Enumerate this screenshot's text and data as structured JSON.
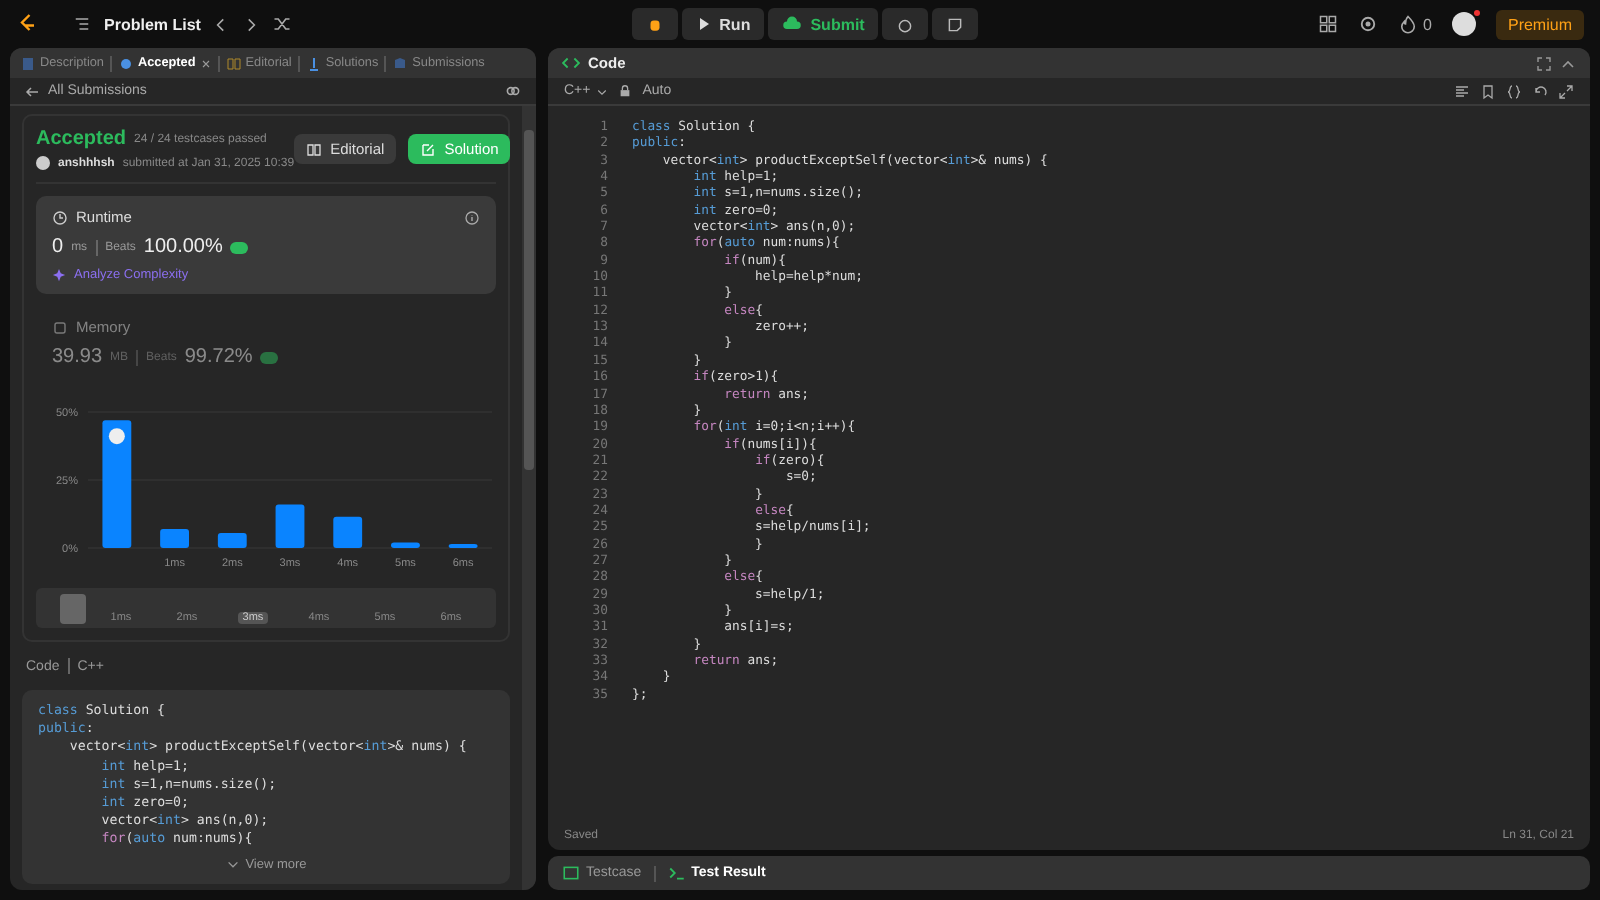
{
  "top_bar": {
    "problem_list": "Problem List",
    "run": "Run",
    "submit": "Submit",
    "streak": "0",
    "premium": "Premium"
  },
  "left_panel": {
    "tabs": [
      {
        "label": "Description",
        "selected": false,
        "closable": false
      },
      {
        "label": "Accepted",
        "selected": true,
        "closable": true
      },
      {
        "label": "Editorial",
        "selected": false,
        "closable": false
      },
      {
        "label": "Solutions",
        "selected": false,
        "closable": false
      },
      {
        "label": "Submissions",
        "selected": false,
        "closable": false
      }
    ],
    "back_link": "All Submissions",
    "result": {
      "status": "Accepted",
      "testcases": "24 / 24 testcases passed",
      "user": "anshhhsh",
      "submitted": "submitted at Jan 31, 2025 10:39",
      "editorial_button": "Editorial",
      "solution_button": "Solution"
    },
    "runtime": {
      "title": "Runtime",
      "value": "0",
      "unit": "ms",
      "beats_label": "Beats",
      "beats": "100.00%",
      "analyze": "Analyze Complexity",
      "selected": true
    },
    "memory": {
      "title": "Memory",
      "value": "39.93",
      "unit": "MB",
      "beats_label": "Beats",
      "beats": "99.72%",
      "selected": false
    },
    "chart_data": {
      "type": "bar",
      "categories": [
        null,
        "1ms",
        "2ms",
        "3ms",
        "4ms",
        "5ms",
        "6ms"
      ],
      "ylim": [
        0,
        50
      ],
      "yticks": [
        {
          "value": 0,
          "label": "0%"
        },
        {
          "value": 25,
          "label": "25%"
        },
        {
          "value": 50,
          "label": "50%"
        }
      ],
      "series": [
        {
          "color": "#0a84ff",
          "values": [
            47,
            7,
            5.5,
            16,
            11.5,
            2,
            1.5
          ]
        }
      ]
    },
    "overview": [
      {
        "label": "1ms",
        "selected": false
      },
      {
        "label": "2ms",
        "selected": false
      },
      {
        "label": "3ms",
        "selected": true
      },
      {
        "label": "4ms",
        "selected": false
      },
      {
        "label": "5ms",
        "selected": false
      },
      {
        "label": "6ms",
        "selected": false
      }
    ],
    "code_header": {
      "title": "Code",
      "language": "C++"
    },
    "code_preview": [
      "class Solution {",
      "public:",
      "    vector<int> productExceptSelf(vector<int>& nums) {",
      "        int help=1;",
      "        int s=1,n=nums.size();",
      "        int zero=0;",
      "        vector<int> ans(n,0);",
      "        for(auto num:nums){"
    ],
    "view_more": "View more"
  },
  "code_panel": {
    "title": "Code",
    "language": "C++",
    "mode": "Auto",
    "lines": [
      {
        "n": "1",
        "code": "class Solution {"
      },
      {
        "n": "2",
        "code": "public:"
      },
      {
        "n": "3",
        "code": "    vector<int> productExceptSelf(vector<int>& nums) {"
      },
      {
        "n": "4",
        "code": "        int help=1;"
      },
      {
        "n": "5",
        "code": "        int s=1,n=nums.size();"
      },
      {
        "n": "6",
        "code": "        int zero=0;"
      },
      {
        "n": "7",
        "code": "        vector<int> ans(n,0);"
      },
      {
        "n": "8",
        "code": "        for(auto num:nums){"
      },
      {
        "n": "9",
        "code": "            if(num){"
      },
      {
        "n": "10",
        "code": "                help=help*num;"
      },
      {
        "n": "11",
        "code": "            }"
      },
      {
        "n": "12",
        "code": "            else{"
      },
      {
        "n": "13",
        "code": "                zero++;"
      },
      {
        "n": "14",
        "code": "            }"
      },
      {
        "n": "15",
        "code": "        }"
      },
      {
        "n": "16",
        "code": "        if(zero>1){"
      },
      {
        "n": "17",
        "code": "            return ans;"
      },
      {
        "n": "18",
        "code": "        }"
      },
      {
        "n": "19",
        "code": "        for(int i=0;i<n;i++){"
      },
      {
        "n": "20",
        "code": "            if(nums[i]){"
      },
      {
        "n": "21",
        "code": "                if(zero){"
      },
      {
        "n": "22",
        "code": "                    s=0;"
      },
      {
        "n": "23",
        "code": "                }"
      },
      {
        "n": "24",
        "code": "                else{"
      },
      {
        "n": "25",
        "code": "                s=help/nums[i];"
      },
      {
        "n": "26",
        "code": "                }"
      },
      {
        "n": "27",
        "code": "            }"
      },
      {
        "n": "28",
        "code": "            else{"
      },
      {
        "n": "29",
        "code": "                s=help/1;"
      },
      {
        "n": "30",
        "code": "            }"
      },
      {
        "n": "31",
        "code": "            ans[i]=s;"
      },
      {
        "n": "32",
        "code": "        }"
      },
      {
        "n": "33",
        "code": "        return ans;"
      },
      {
        "n": "34",
        "code": "    }"
      },
      {
        "n": "35",
        "code": "};"
      }
    ],
    "status": "Saved",
    "cursor": "Ln 31, Col 21"
  },
  "console": {
    "tabs": [
      {
        "label": "Testcase",
        "selected": false
      },
      {
        "label": "Test Result",
        "selected": true
      }
    ]
  }
}
